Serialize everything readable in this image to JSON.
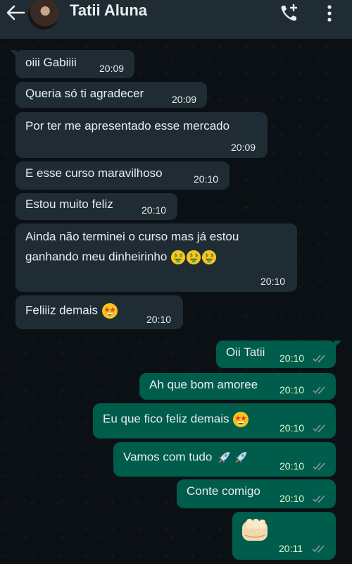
{
  "header": {
    "contact_name": "Tatii Aluna",
    "icons": [
      "back-arrow-icon",
      "avatar",
      "add-call-icon",
      "more-vertical-icon"
    ]
  },
  "messages": [
    {
      "dir": "in",
      "text": "oiii Gabiiii",
      "time": "20:09"
    },
    {
      "dir": "in",
      "text": "Queria só ti agradecer",
      "time": "20:09"
    },
    {
      "dir": "in",
      "text": "Por ter me apresentado esse mercado",
      "time": "20:09"
    },
    {
      "dir": "in",
      "text": "E esse curso maravilhoso",
      "time": "20:10"
    },
    {
      "dir": "in",
      "text": "Estou muito feliz",
      "time": "20:10"
    },
    {
      "dir": "in",
      "line1": "Ainda não terminei o curso mas já estou",
      "line2": "ganhando meu dinheirinho",
      "emoji": "money-mouth-face x3",
      "time": "20:10"
    },
    {
      "dir": "in",
      "text": "Feliiiz demais",
      "emoji": "star-struck-face",
      "time": "20:10"
    },
    {
      "dir": "out",
      "text": "Oii Tatii",
      "time": "20:10",
      "status": "read"
    },
    {
      "dir": "out",
      "text": "Ah que bom amoree",
      "time": "20:10",
      "status": "read"
    },
    {
      "dir": "out",
      "text": "Eu que fico feliz demais",
      "emoji": "star-struck-face",
      "time": "20:10",
      "status": "read"
    },
    {
      "dir": "out",
      "text": "Vamos com tudo",
      "emoji": "rocket x2",
      "time": "20:10",
      "status": "read"
    },
    {
      "dir": "out",
      "text": "Conte comigo",
      "time": "20:10",
      "status": "read"
    },
    {
      "dir": "out",
      "emoji": "oncoming-fist",
      "time": "20:11",
      "status": "read"
    }
  ],
  "colors": {
    "header_bg": "#1f2c34",
    "incoming_bubble": "#1f2c34",
    "outgoing_bubble": "#005c4b",
    "read_ticks": "#8696a0"
  }
}
